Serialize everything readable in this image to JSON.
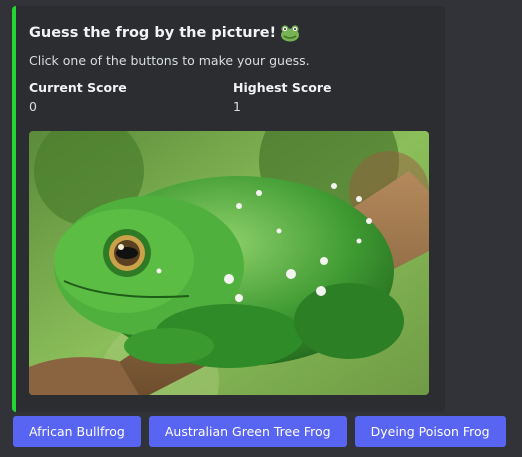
{
  "embed": {
    "title": "Guess the frog by the picture!",
    "title_icon": "frog-emoji-icon",
    "description": "Click one of the buttons to make your guess.",
    "accent_color": "#23d636",
    "fields": [
      {
        "name": "Current Score",
        "value": "0"
      },
      {
        "name": "Highest Score",
        "value": "1"
      }
    ],
    "image": "frog-photo"
  },
  "buttons": [
    {
      "label": "African Bullfrog"
    },
    {
      "label": "Australian Green Tree Frog"
    },
    {
      "label": "Dyeing Poison Frog"
    }
  ],
  "colors": {
    "background": "#313338",
    "embed_background": "#2b2d31",
    "button": "#5865f2"
  }
}
